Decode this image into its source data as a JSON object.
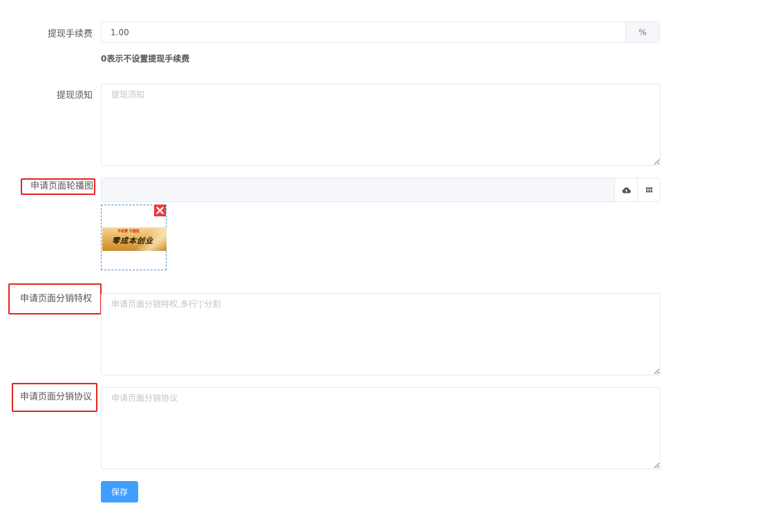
{
  "fee": {
    "label": "提现手续费",
    "value": "1.00",
    "unit": "%",
    "help": "0表示不设置提现手续费"
  },
  "notice": {
    "label": "提现须知",
    "placeholder": "提现须知"
  },
  "carousel": {
    "label": "申请页面轮播图",
    "image": {
      "tag_line": "不收费  不囤货",
      "headline": "零成本创业"
    }
  },
  "privileges": {
    "label": "申请页面分销特权",
    "placeholder": "申请页面分销特权,多行'|'分割"
  },
  "agreement": {
    "label": "申请页面分销协议",
    "placeholder": "申请页面分销协议"
  },
  "actions": {
    "save_label": "保存"
  },
  "colors": {
    "primary": "#409eff",
    "highlight_border": "#e0251c",
    "delete": "#e2403a"
  }
}
